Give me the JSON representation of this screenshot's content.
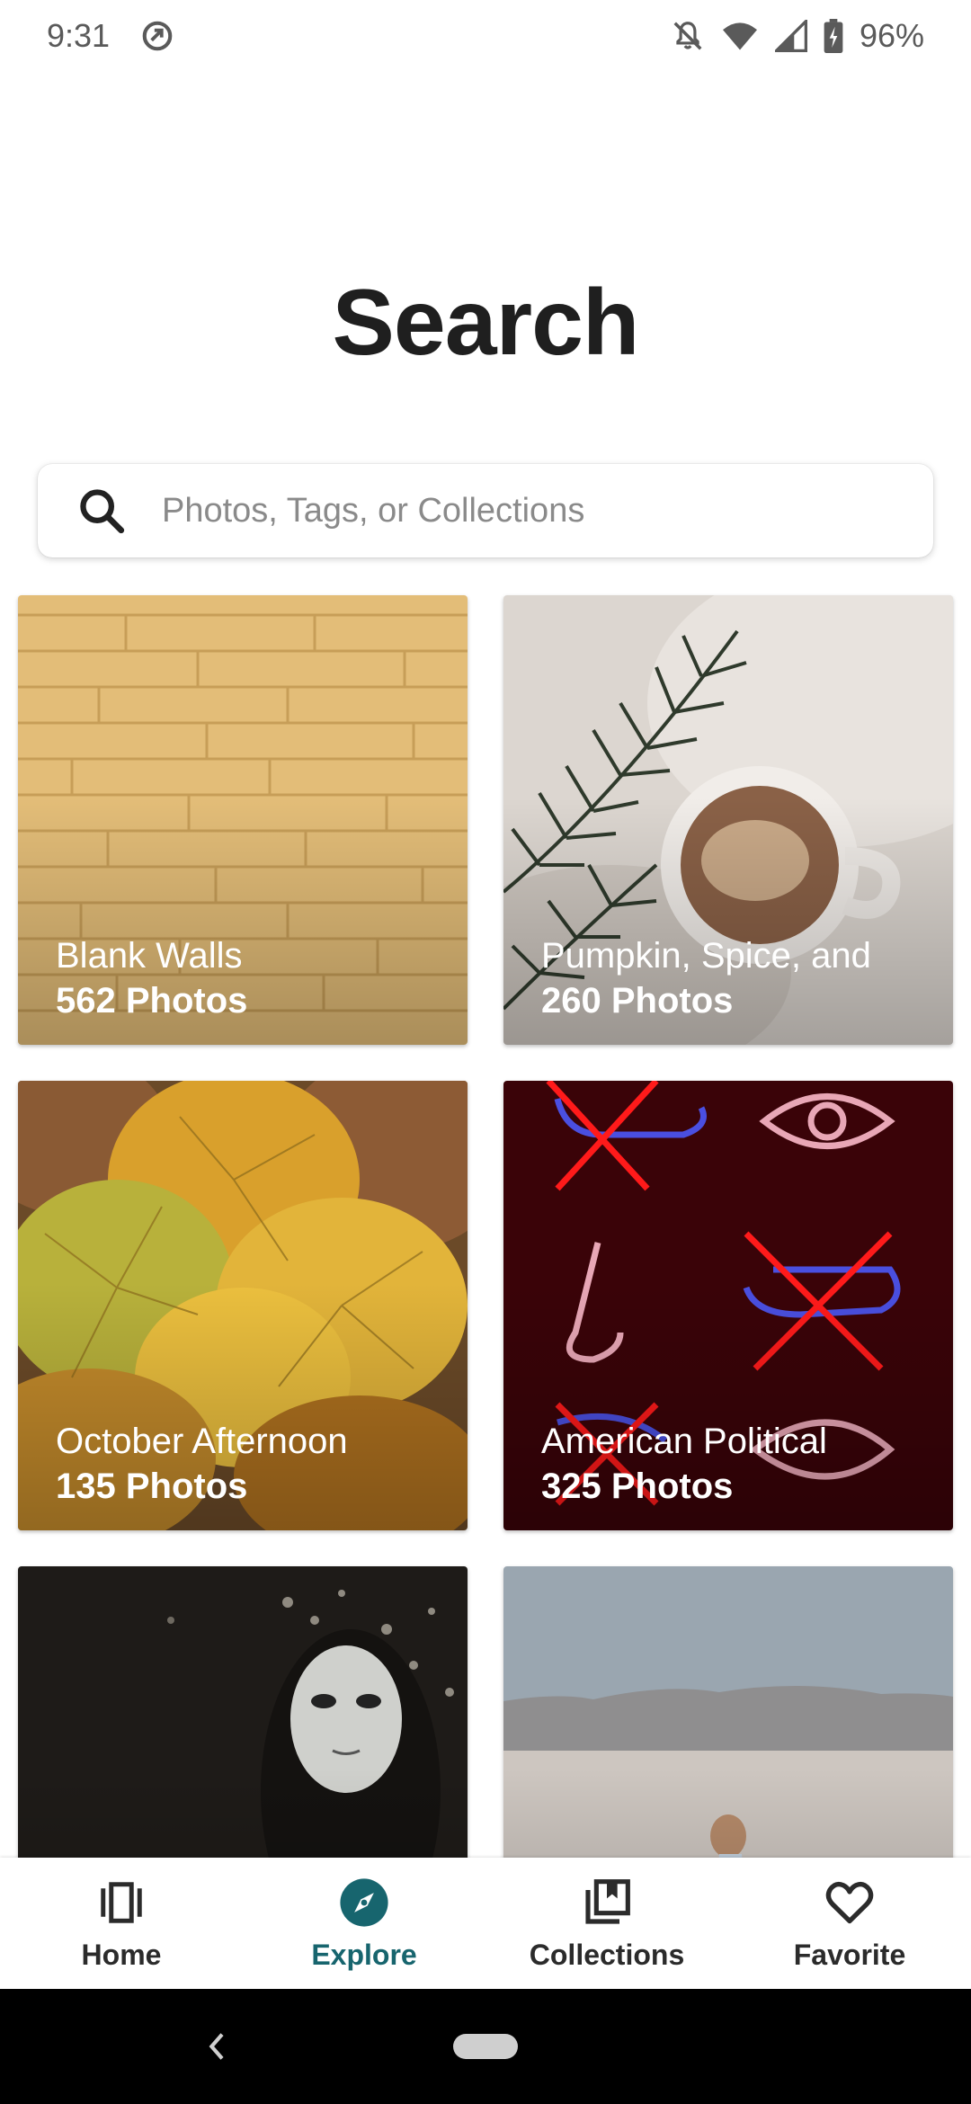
{
  "status_bar": {
    "time": "9:31",
    "battery": "96%",
    "icons": [
      "data-saver-icon",
      "mute-bell-icon",
      "wifi-icon",
      "cell-signal-icon",
      "battery-icon"
    ]
  },
  "page": {
    "title": "Search"
  },
  "search": {
    "placeholder": "Photos, Tags, or Collections",
    "value": ""
  },
  "cards": [
    {
      "title": "Blank Walls",
      "count": "562 Photos",
      "image": "yellow brick wall"
    },
    {
      "title": "Pumpkin, Spice, and",
      "count": "260 Photos",
      "image": "coffee cup with fir branch"
    },
    {
      "title": "October Afternoon",
      "count": "135 Photos",
      "image": "autumn leaves"
    },
    {
      "title": "American Political",
      "count": "325 Photos",
      "image": "neon signs"
    },
    {
      "title": "",
      "count": "",
      "image": "white mask in dark forest"
    },
    {
      "title": "",
      "count": "",
      "image": "girl riding bike in desert"
    }
  ],
  "bottom_nav": {
    "items": [
      {
        "label": "Home",
        "icon": "carousel-icon",
        "active": false
      },
      {
        "label": "Explore",
        "icon": "compass-icon",
        "active": true
      },
      {
        "label": "Collections",
        "icon": "library-bookmark-icon",
        "active": false
      },
      {
        "label": "Favorite",
        "icon": "heart-icon",
        "active": false
      }
    ]
  },
  "colors": {
    "accent": "#17656e",
    "title": "#1f1f1f",
    "nav_bar": "#000000"
  }
}
